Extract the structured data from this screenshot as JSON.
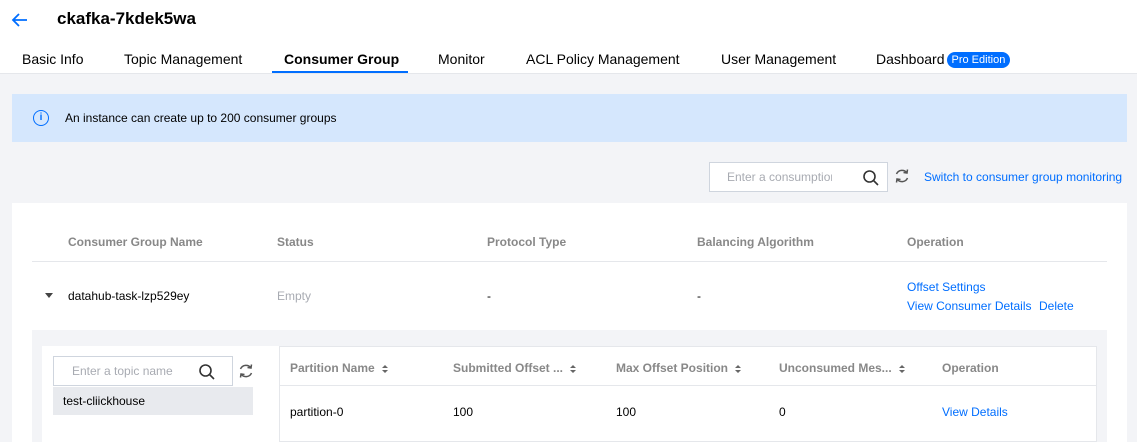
{
  "header": {
    "title": "ckafka-7kdek5wa"
  },
  "tabs": [
    {
      "label": "Basic Info"
    },
    {
      "label": "Topic Management"
    },
    {
      "label": "Consumer Group"
    },
    {
      "label": "Monitor"
    },
    {
      "label": "ACL Policy Management"
    },
    {
      "label": "User Management"
    },
    {
      "label": "Dashboard",
      "badge": "Pro Edition"
    }
  ],
  "active_tab": "Consumer Group",
  "notice": {
    "text": "An instance can create up to 200 consumer groups"
  },
  "toolbar": {
    "search_placeholder": "Enter a consumption group name",
    "switch_link": "Switch to consumer group monitoring"
  },
  "table": {
    "headers": [
      "Consumer Group Name",
      "Status",
      "Protocol Type",
      "Balancing Algorithm",
      "Operation"
    ],
    "rows": [
      {
        "name": "datahub-task-lzp529ey",
        "status": "Empty",
        "protocol": "-",
        "algorithm": "-",
        "actions": [
          "Offset Settings",
          "View Consumer Details",
          "Delete"
        ]
      }
    ]
  },
  "detail": {
    "topic_search_placeholder": "Enter a topic name",
    "topics": [
      "test-cliickhouse"
    ],
    "headers": [
      "Partition Name",
      "Submitted Offset ...",
      "Max Offset Position",
      "Unconsumed Mes...",
      "Operation"
    ],
    "rows": [
      {
        "partition": "partition-0",
        "submitted": "100",
        "max": "100",
        "unconsumed": "0",
        "action": "View Details"
      }
    ]
  },
  "colors": {
    "accent": "#006eff",
    "notice_bg": "#d5e7fd"
  }
}
